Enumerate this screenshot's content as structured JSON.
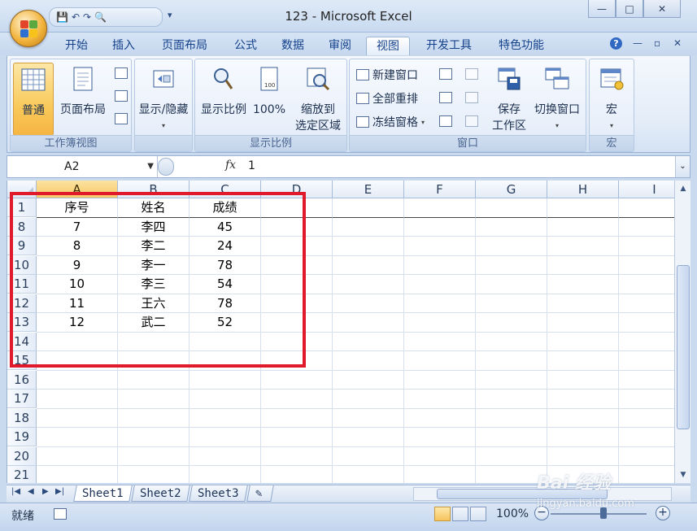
{
  "window": {
    "title": "123 - Microsoft Excel",
    "qat_undo": "↶",
    "qat_redo": "↷",
    "qat_save": "💾",
    "qat_preview": "🔍",
    "qat_more": "▾",
    "minimize": "—",
    "maximize": "□",
    "close": "✕"
  },
  "tabs": [
    {
      "label": "开始"
    },
    {
      "label": "插入"
    },
    {
      "label": "页面布局"
    },
    {
      "label": "公式"
    },
    {
      "label": "数据"
    },
    {
      "label": "审阅"
    },
    {
      "label": "视图",
      "active": true
    },
    {
      "label": "开发工具"
    },
    {
      "label": "特色功能"
    }
  ],
  "ribbon_right": {
    "help": "?",
    "min": "—",
    "restore": "▫",
    "close": "✕"
  },
  "groups": {
    "workbook_views": {
      "label": "工作簿视图",
      "normal": "普通",
      "page_layout": "页面布局"
    },
    "show_hide": {
      "label": "显示/隐藏",
      "dropdown": "▾"
    },
    "zoom": {
      "label": "显示比例",
      "zoom": "显示比例",
      "zoom100": "100%",
      "zoom_selection_1": "缩放到",
      "zoom_selection_2": "选定区域"
    },
    "window": {
      "label": "窗口",
      "new_window": "新建窗口",
      "arrange_all": "全部重排",
      "freeze_panes": "冻结窗格",
      "save_workspace_1": "保存",
      "save_workspace_2": "工作区",
      "switch_windows": "切换窗口"
    },
    "macros": {
      "label": "宏",
      "macros": "宏"
    }
  },
  "formula_bar": {
    "name_box": "A2",
    "fx": "fx",
    "value": "1"
  },
  "columns": [
    "A",
    "B",
    "C",
    "D",
    "E",
    "F",
    "G",
    "H",
    "I"
  ],
  "rows": [
    {
      "num": "1",
      "cells": [
        "序号",
        "姓名",
        "成绩"
      ]
    },
    {
      "num": "8",
      "cells": [
        "7",
        "李四",
        "45"
      ]
    },
    {
      "num": "9",
      "cells": [
        "8",
        "李二",
        "24"
      ]
    },
    {
      "num": "10",
      "cells": [
        "9",
        "李一",
        "78"
      ]
    },
    {
      "num": "11",
      "cells": [
        "10",
        "李三",
        "54"
      ]
    },
    {
      "num": "12",
      "cells": [
        "11",
        "王六",
        "78"
      ]
    },
    {
      "num": "13",
      "cells": [
        "12",
        "武二",
        "52"
      ]
    },
    {
      "num": "14",
      "cells": [
        "",
        "",
        ""
      ]
    },
    {
      "num": "15",
      "cells": [
        "",
        "",
        ""
      ]
    },
    {
      "num": "16",
      "cells": [
        "",
        "",
        ""
      ]
    },
    {
      "num": "17",
      "cells": [
        "",
        "",
        ""
      ]
    },
    {
      "num": "18",
      "cells": [
        "",
        "",
        ""
      ]
    },
    {
      "num": "19",
      "cells": [
        "",
        "",
        ""
      ]
    },
    {
      "num": "20",
      "cells": [
        "",
        "",
        ""
      ]
    },
    {
      "num": "21",
      "cells": [
        "",
        "",
        ""
      ]
    }
  ],
  "sheets": [
    "Sheet1",
    "Sheet2",
    "Sheet3"
  ],
  "status": {
    "ready": "就绪",
    "zoom": "100%",
    "zoom_minus": "−",
    "zoom_plus": "+"
  },
  "watermark": {
    "line1": "Bai 经验",
    "line2": "jingyan.baidu.com"
  },
  "colors": {
    "accent": "#15428b",
    "highlight": "#e01a2b"
  }
}
